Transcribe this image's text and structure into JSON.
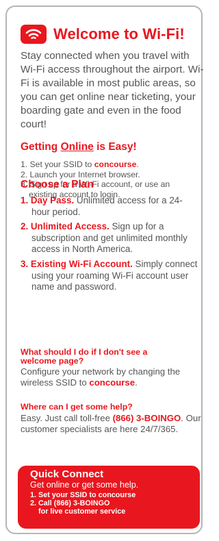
{
  "header": {
    "title": "Welcome to Wi-Fi!",
    "icon": "wifi-icon"
  },
  "intro": "Stay connected when you travel with Wi-Fi access throughout the airport. Wi-Fi is available in most public areas, so you can get online near ticketing, your boarding gate and even in the food court!",
  "getting_online": {
    "heading_pre": "Getting ",
    "heading_underlined": "Online",
    "heading_post": " is Easy!",
    "step1_pre": "1. Set your SSID to ",
    "step1_kw": "concourse",
    "step1_post": ".",
    "step2": "2. Launch your Internet browser.",
    "step3": "3. Sign up for a Wi-Fi account, or use an existing account to login."
  },
  "plans": {
    "heading": "Choose a Plan",
    "items": [
      {
        "title": "1. Day Pass.",
        "text": " Unlimited access for a 24-hour period."
      },
      {
        "title": "2. Unlimited Access.",
        "text": " Sign up for a subscription and get unlimited monthly access in North America."
      },
      {
        "title": "3. Existing Wi-Fi Account.",
        "text": " Simply connect using your roaming Wi-Fi account user name and password."
      }
    ]
  },
  "faq": {
    "q1": "What should I do if I don't see a welcome page?",
    "a1_pre": "Configure your network by changing the wireless SSID to ",
    "a1_kw": "concourse",
    "a1_post": ".",
    "q2": "Where can I get some help?",
    "a2_pre": "Easy. Just call toll-free ",
    "a2_kw": "(866) 3-BOINGO",
    "a2_post": ". Our customer specialists are here 24/7/365."
  },
  "quick_connect": {
    "title": "Quick Connect",
    "subtitle": "Get online or get some help.",
    "step1": "1. Set your SSID to concourse",
    "step2": "2. Call (866) 3-BOINGO",
    "step2_cont": "for live customer service"
  },
  "colors": {
    "accent": "#e8171f",
    "text": "#555555",
    "border": "#b5b5b5"
  }
}
